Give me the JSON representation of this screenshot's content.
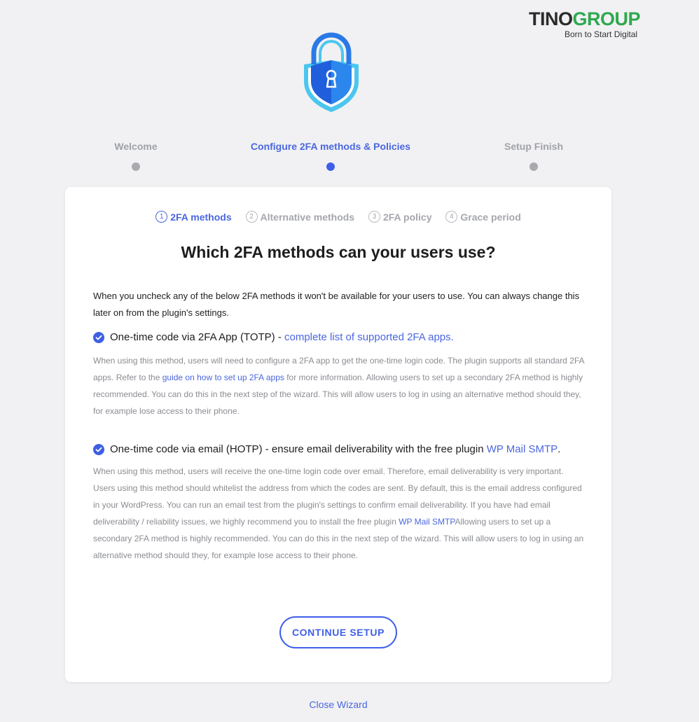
{
  "brand": {
    "name_part1": "TINO",
    "name_part2": "GROUP",
    "tagline": "Born to Start Digital"
  },
  "steps": [
    {
      "label": "Welcome",
      "state": "inactive"
    },
    {
      "label": "Configure 2FA methods & Policies",
      "state": "active"
    },
    {
      "label": "Setup Finish",
      "state": "inactive"
    }
  ],
  "substeps": [
    {
      "num": "1",
      "label": "2FA methods",
      "state": "active"
    },
    {
      "num": "2",
      "label": "Alternative methods",
      "state": "inactive"
    },
    {
      "num": "3",
      "label": "2FA policy",
      "state": "inactive"
    },
    {
      "num": "4",
      "label": "Grace period",
      "state": "inactive"
    }
  ],
  "card": {
    "title": "Which 2FA methods can your users use?",
    "intro": "When you uncheck any of the below 2FA methods it won't be available for your users to use. You can always change this later on from the plugin's settings."
  },
  "methods": [
    {
      "checked": true,
      "label": "One-time code via 2FA App (TOTP) - ",
      "link": "complete list of supported 2FA apps.",
      "desc_part1": "When using this method, users will need to configure a 2FA app to get the one-time login code. The plugin supports all standard 2FA apps. Refer to the ",
      "desc_link": "guide on how to set up 2FA apps",
      "desc_part2": " for more information. Allowing users to set up a secondary 2FA method is highly recommended. You can do this in the next step of the wizard. This will allow users to log in using an alternative method should they, for example lose access to their phone."
    },
    {
      "checked": true,
      "label": "One-time code via email (HOTP) - ensure email deliverability with the free plugin ",
      "link": "WP Mail SMTP",
      "label_end": ".",
      "desc_part1": "When using this method, users will receive the one-time login code over email. Therefore, email deliverability is very important. Users using this method should whitelist the address from which the codes are sent. By default, this is the email address configured in your WordPress. You can run an email test from the plugin's settings to confirm email deliverability. If you have had email deliverability / reliability issues, we highly recommend you to install the free plugin ",
      "desc_link": "WP Mail SMTP",
      "desc_part2": "Allowing users to set up a secondary 2FA method is highly recommended. You can do this in the next step of the wizard. This will allow users to log in using an alternative method should they, for example lose access to their phone."
    }
  ],
  "buttons": {
    "continue": "CONTINUE SETUP",
    "close": "Close Wizard"
  },
  "colors": {
    "accent": "#3f5fe8",
    "brand_green": "#2fa84f",
    "inactive": "#a0a2a8"
  }
}
